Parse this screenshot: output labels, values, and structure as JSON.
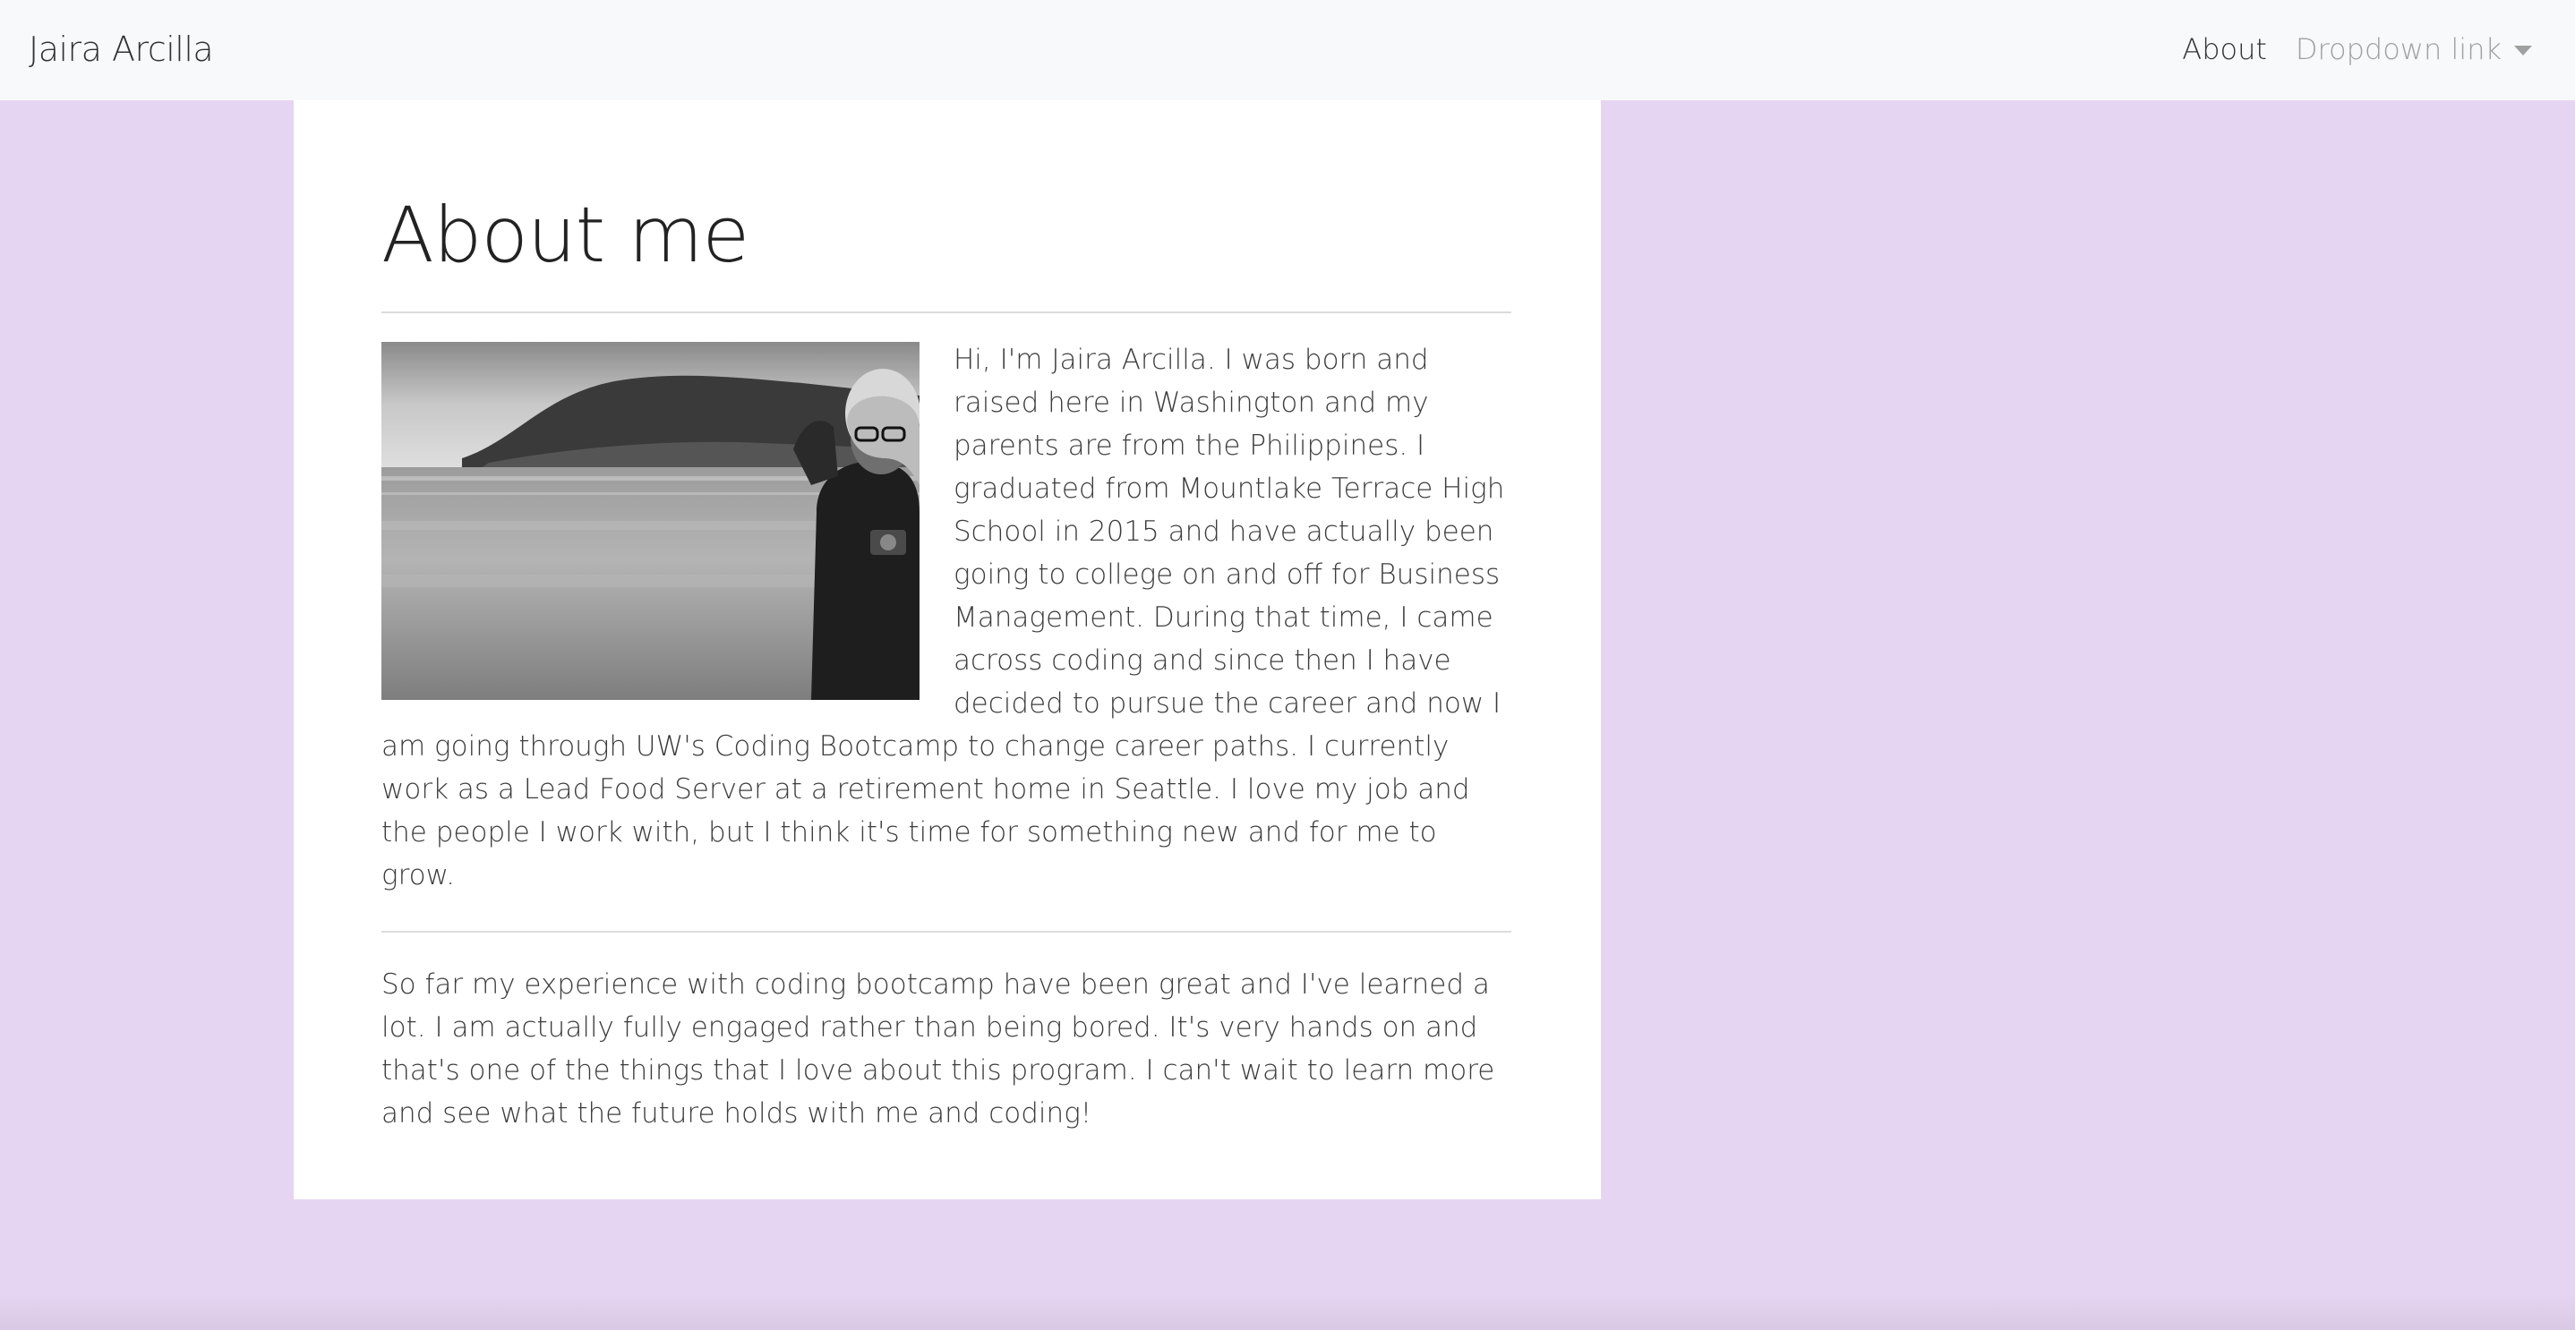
{
  "navbar": {
    "brand": "Jaira Arcilla",
    "links": {
      "about": "About",
      "dropdown": "Dropdown link"
    }
  },
  "main": {
    "title": "About me",
    "photo_icon": "portrait-photo",
    "paragraphs": [
      "Hi, I'm Jaira Arcilla. I was born and raised here in Washington and my parents are from the Philippines. I graduated from Mountlake Terrace High School in 2015 and have actually been going to college on and off for Business Management. During that time, I came across coding and since then I have decided to pursue the career and now I am going through UW's Coding Bootcamp to change career paths. I currently work as a Lead Food Server at a retirement home in Seattle. I love my job and the people I work with, but I think it's time for something new and for me to grow.",
      "So far my experience with coding bootcamp have been great and I've learned a lot. I am actually fully engaged rather than being bored. It's very hands on and that's one of the things that I love about this program. I can't wait to learn more and see what the future holds with me and coding!"
    ]
  },
  "colors": {
    "page_background": "#e6d5f2",
    "navbar_background": "#f8f9fa",
    "card_background": "#ffffff",
    "muted_link": "#a0a0a0"
  }
}
